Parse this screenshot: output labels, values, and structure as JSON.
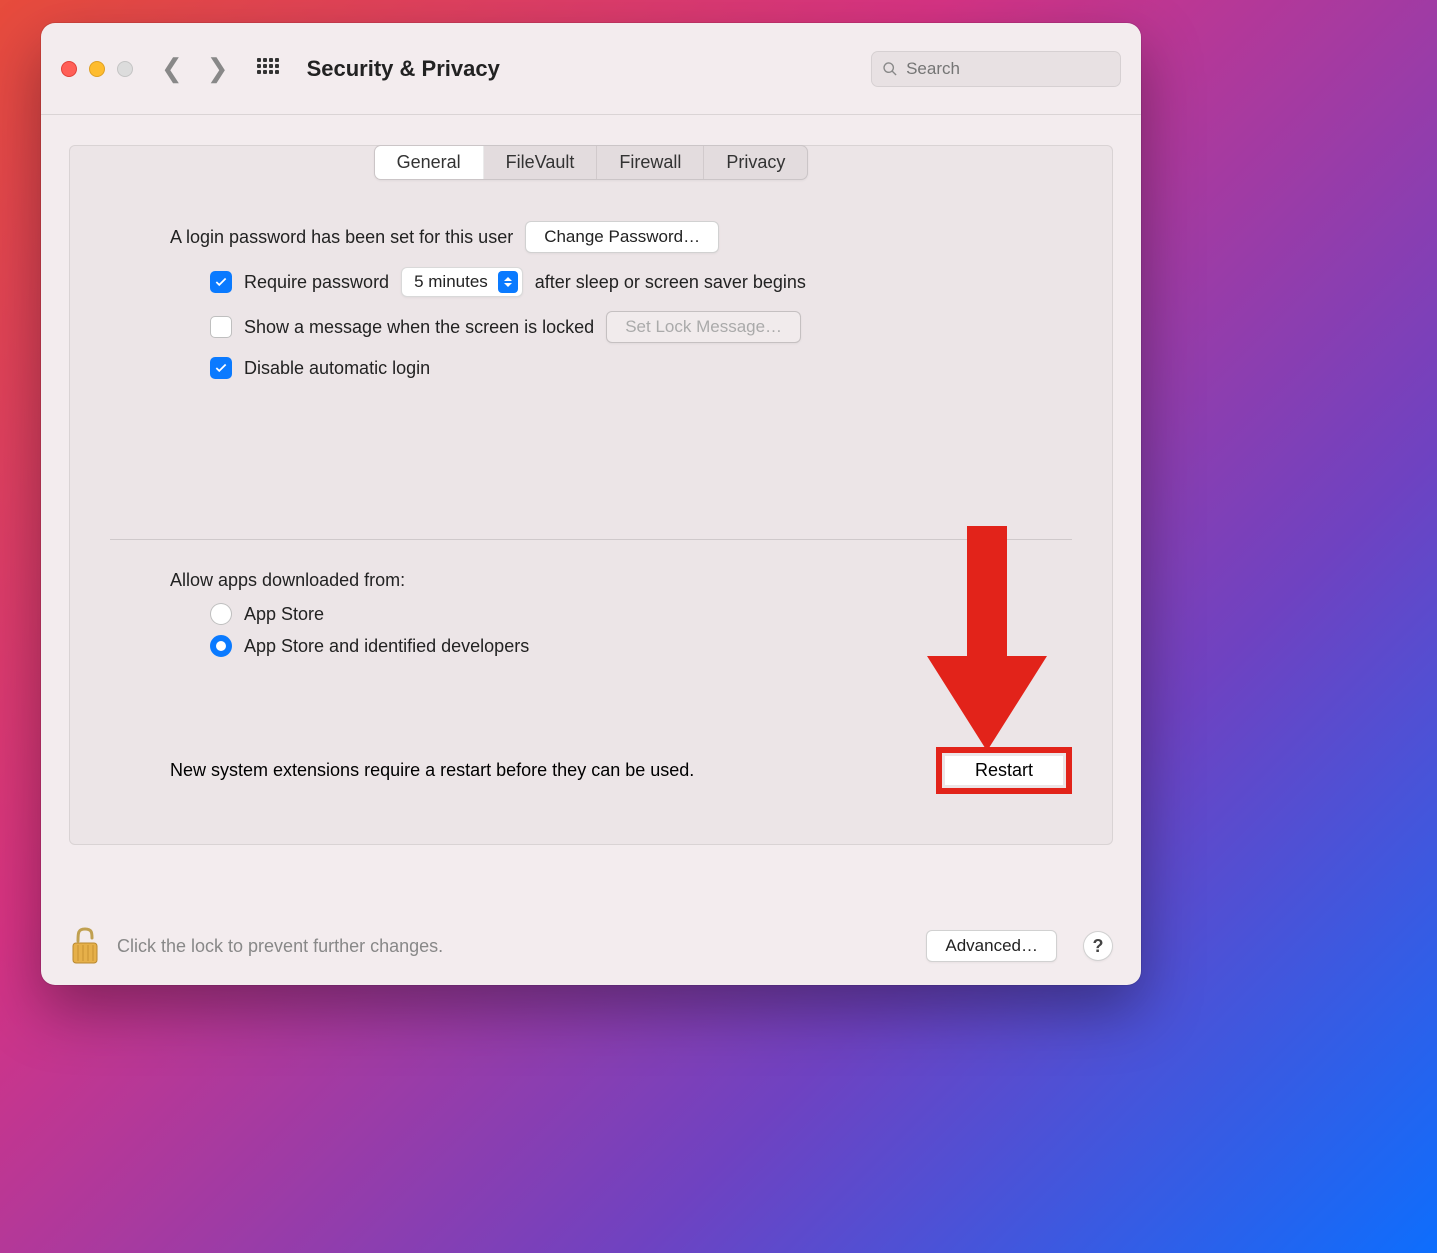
{
  "window": {
    "title": "Security & Privacy"
  },
  "search": {
    "placeholder": "Search"
  },
  "tabs": [
    {
      "label": "General",
      "active": true
    },
    {
      "label": "FileVault",
      "active": false
    },
    {
      "label": "Firewall",
      "active": false
    },
    {
      "label": "Privacy",
      "active": false
    }
  ],
  "general": {
    "login_password_text": "A login password has been set for this user",
    "change_password_button": "Change Password…",
    "require_password": {
      "checked": true,
      "label_before": "Require password",
      "delay_value": "5 minutes",
      "label_after": "after sleep or screen saver begins"
    },
    "show_message": {
      "checked": false,
      "label": "Show a message when the screen is locked",
      "button": "Set Lock Message…",
      "button_disabled": true
    },
    "disable_auto_login": {
      "checked": true,
      "label": "Disable automatic login"
    },
    "allow_apps": {
      "heading": "Allow apps downloaded from:",
      "options": [
        {
          "label": "App Store",
          "selected": false
        },
        {
          "label": "App Store and identified developers",
          "selected": true
        }
      ]
    },
    "restart": {
      "message": "New system extensions require a restart before they can be used.",
      "button": "Restart"
    }
  },
  "footer": {
    "lock_text": "Click the lock to prevent further changes.",
    "advanced_button": "Advanced…",
    "help": "?"
  },
  "colors": {
    "accent": "#0a7aff",
    "annotation": "#e2231a"
  }
}
